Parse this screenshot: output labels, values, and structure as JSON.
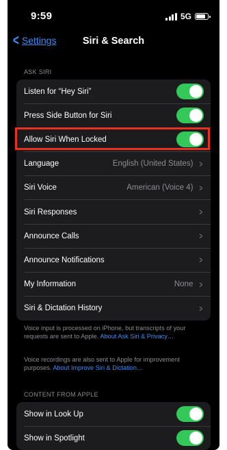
{
  "status_bar": {
    "time": "9:59",
    "network": "5G"
  },
  "nav": {
    "back_label": "Settings",
    "title": "Siri & Search"
  },
  "ask_siri": {
    "header": "ASK SIRI",
    "toggles": [
      {
        "label": "Listen for “Hey Siri”",
        "on": true
      },
      {
        "label": "Press Side Button for Siri",
        "on": true
      },
      {
        "label": "Allow Siri When Locked",
        "on": true
      }
    ],
    "language": {
      "label": "Language",
      "value": "English (United States)"
    },
    "siri_voice": {
      "label": "Siri Voice",
      "value": "American (Voice 4)"
    },
    "siri_responses": {
      "label": "Siri Responses"
    },
    "announce_calls": {
      "label": "Announce Calls"
    },
    "announce_notifications": {
      "label": "Announce Notifications"
    },
    "my_information": {
      "label": "My Information",
      "value": "None"
    },
    "history": {
      "label": "Siri & Dictation History"
    }
  },
  "footnotes": {
    "voice_input_text": "Voice input is processed on iPhone, but transcripts of your requests are sent to Apple. ",
    "voice_input_link": "About Ask Siri & Privacy…",
    "recordings_text": "Voice recordings are also sent to Apple for improvement purposes. ",
    "recordings_link": "About Improve Siri & Dictation…"
  },
  "content_from_apple": {
    "header": "CONTENT FROM APPLE",
    "toggles": [
      {
        "label": "Show in Look Up",
        "on": true
      },
      {
        "label": "Show in Spotlight",
        "on": true
      }
    ]
  },
  "colors": {
    "toggle_on": "#34c759",
    "accent": "#3d8df5",
    "highlight": "#e8321f"
  }
}
